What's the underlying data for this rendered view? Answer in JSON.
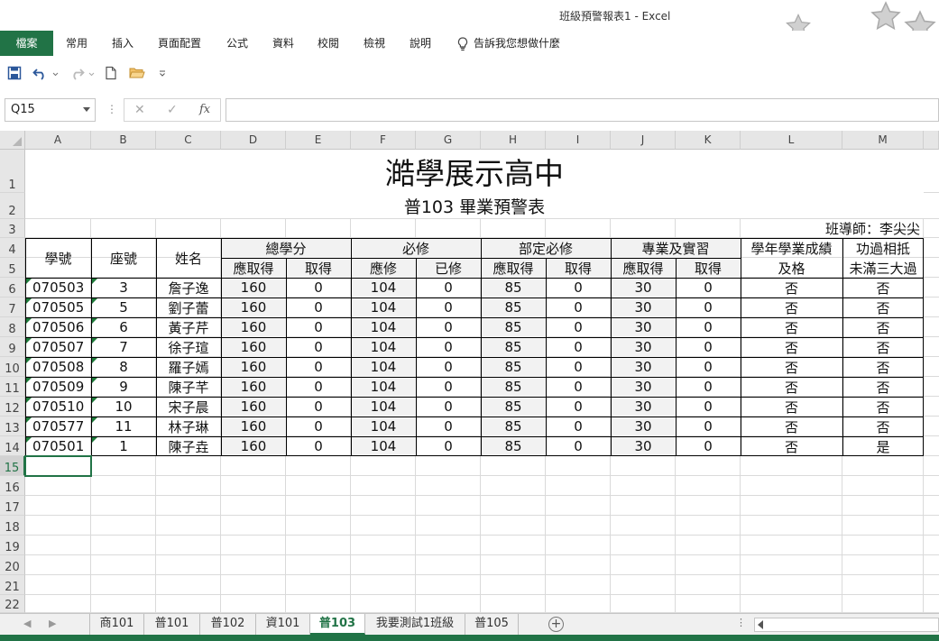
{
  "window": {
    "title": "班級預警報表1  -  Excel"
  },
  "ribbon": {
    "file_tab": "檔案",
    "tabs": [
      "常用",
      "插入",
      "頁面配置",
      "公式",
      "資料",
      "校閱",
      "檢視",
      "說明"
    ],
    "tell_me": "告訴我您想做什麼"
  },
  "formula_bar": {
    "name_box": "Q15",
    "fx": "fx",
    "content": ""
  },
  "columns": [
    "A",
    "B",
    "C",
    "D",
    "E",
    "F",
    "G",
    "H",
    "I",
    "J",
    "K",
    "L",
    "M"
  ],
  "rows": [
    "1",
    "2",
    "3",
    "4",
    "5",
    "6",
    "7",
    "8",
    "9",
    "10",
    "11",
    "12",
    "13",
    "14",
    "15",
    "16",
    "17",
    "18",
    "19",
    "20",
    "21",
    "22"
  ],
  "selected_row": "15",
  "sheet": {
    "school": "澔學展示高中",
    "report": "普103 畢業預警表",
    "teacher": "班導師：李尖尖",
    "headers": {
      "id": "學號",
      "seat": "座號",
      "name": "姓名",
      "total": "總學分",
      "required": "必修",
      "dept_required": "部定必修",
      "practice": "專業及實習",
      "passed_line1": "學年學業成績",
      "passed_line2": "及格",
      "merit_line1": "功過相抵",
      "merit_line2": "未滿三大過",
      "should_earn": "應取得",
      "earned": "取得",
      "should_take": "應修",
      "taken": "已修"
    },
    "students": [
      [
        "070503",
        "3",
        "詹子逸",
        "160",
        "0",
        "104",
        "0",
        "85",
        "0",
        "30",
        "0",
        "否",
        "否"
      ],
      [
        "070505",
        "5",
        "劉子蕾",
        "160",
        "0",
        "104",
        "0",
        "85",
        "0",
        "30",
        "0",
        "否",
        "否"
      ],
      [
        "070506",
        "6",
        "黃子芹",
        "160",
        "0",
        "104",
        "0",
        "85",
        "0",
        "30",
        "0",
        "否",
        "否"
      ],
      [
        "070507",
        "7",
        "徐子瑄",
        "160",
        "0",
        "104",
        "0",
        "85",
        "0",
        "30",
        "0",
        "否",
        "否"
      ],
      [
        "070508",
        "8",
        "羅子嫣",
        "160",
        "0",
        "104",
        "0",
        "85",
        "0",
        "30",
        "0",
        "否",
        "否"
      ],
      [
        "070509",
        "9",
        "陳子芊",
        "160",
        "0",
        "104",
        "0",
        "85",
        "0",
        "30",
        "0",
        "否",
        "否"
      ],
      [
        "070510",
        "10",
        "宋子晨",
        "160",
        "0",
        "104",
        "0",
        "85",
        "0",
        "30",
        "0",
        "否",
        "否"
      ],
      [
        "070577",
        "11",
        "林子琳",
        "160",
        "0",
        "104",
        "0",
        "85",
        "0",
        "30",
        "0",
        "否",
        "否"
      ],
      [
        "070501",
        "1",
        "陳子垚",
        "160",
        "0",
        "104",
        "0",
        "85",
        "0",
        "30",
        "0",
        "否",
        "是"
      ]
    ]
  },
  "sheet_tabs": [
    "商101",
    "普101",
    "普102",
    "資101",
    "普103",
    "我要測試1班級",
    "普105"
  ],
  "active_sheet": "普103",
  "colors": {
    "excel_green": "#217346",
    "header_fill": "#f2f2f2"
  }
}
